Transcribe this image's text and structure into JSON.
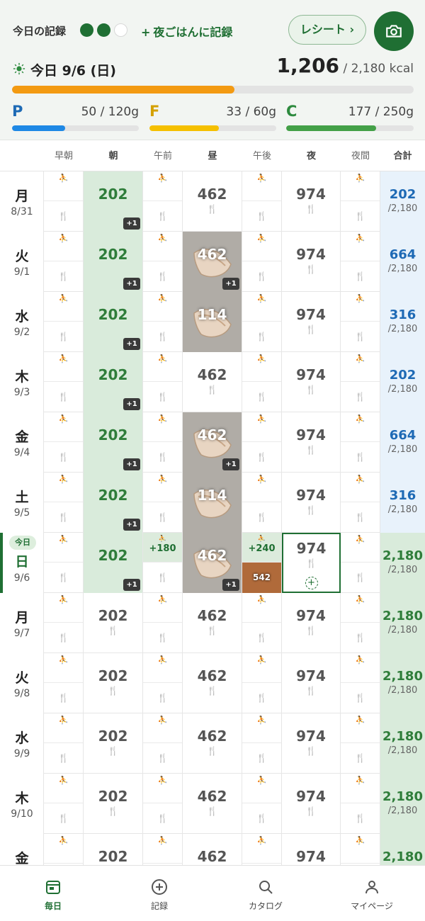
{
  "header": {
    "record_label": "今日の記録",
    "dinner_link": "夜ごはんに記録",
    "receipt_button": "レシート ›",
    "date": "今日 9/6 (日)",
    "kcal_consumed": "1,206",
    "kcal_goal": "/ 2,180 kcal",
    "kcal_progress": 0.553,
    "macros": [
      {
        "letter": "P",
        "value": "50 / 120g",
        "progress": 0.417
      },
      {
        "letter": "F",
        "value": "33 / 60g",
        "progress": 0.55
      },
      {
        "letter": "C",
        "value": "177 / 250g",
        "progress": 0.708
      }
    ]
  },
  "columns": [
    "早朝",
    "朝",
    "午前",
    "昼",
    "午後",
    "夜",
    "夜間",
    "合計"
  ],
  "rows": [
    {
      "dow": "月",
      "date": "8/31",
      "breakfast": {
        "value": "202",
        "extra": "+1"
      },
      "lunch": {
        "value": "462",
        "photo": false
      },
      "dinner": "974",
      "total": "202",
      "goal": "/2,180"
    },
    {
      "dow": "火",
      "date": "9/1",
      "breakfast": {
        "value": "202",
        "extra": "+1"
      },
      "lunch": {
        "value": "462",
        "photo": true,
        "extra": "+1"
      },
      "dinner": "974",
      "total": "664",
      "goal": "/2,180"
    },
    {
      "dow": "水",
      "date": "9/2",
      "breakfast": {
        "value": "202",
        "extra": "+1"
      },
      "lunch": {
        "value": "114",
        "photo": true
      },
      "dinner": "974",
      "total": "316",
      "goal": "/2,180"
    },
    {
      "dow": "木",
      "date": "9/3",
      "breakfast": {
        "value": "202",
        "extra": "+1"
      },
      "lunch": {
        "value": "462",
        "photo": false
      },
      "dinner": "974",
      "total": "202",
      "goal": "/2,180"
    },
    {
      "dow": "金",
      "date": "9/4",
      "breakfast": {
        "value": "202",
        "extra": "+1"
      },
      "lunch": {
        "value": "462",
        "photo": true,
        "extra": "+1"
      },
      "dinner": "974",
      "total": "664",
      "goal": "/2,180"
    },
    {
      "dow": "土",
      "date": "9/5",
      "breakfast": {
        "value": "202",
        "extra": "+1"
      },
      "lunch": {
        "value": "114",
        "photo": true
      },
      "dinner": "974",
      "total": "316",
      "goal": "/2,180"
    },
    {
      "dow": "日",
      "date": "9/6",
      "today": true,
      "today_label": "今日",
      "breakfast": {
        "value": "202",
        "extra": "+1"
      },
      "snack_am": "+180",
      "lunch": {
        "value": "462",
        "photo": true,
        "extra": "+1"
      },
      "snack_pm": "+240",
      "snack_pm_photo": "542",
      "dinner": "974",
      "dinner_selected": true,
      "total": "2,180",
      "goal": "/2,180"
    },
    {
      "dow": "月",
      "date": "9/7",
      "breakfast": {
        "value": "202",
        "plain": true
      },
      "lunch": {
        "value": "462",
        "photo": false
      },
      "dinner": "974",
      "total": "2,180",
      "goal": "/2,180"
    },
    {
      "dow": "火",
      "date": "9/8",
      "breakfast": {
        "value": "202",
        "plain": true
      },
      "lunch": {
        "value": "462",
        "photo": false
      },
      "dinner": "974",
      "total": "2,180",
      "goal": "/2,180"
    },
    {
      "dow": "水",
      "date": "9/9",
      "breakfast": {
        "value": "202",
        "plain": true
      },
      "lunch": {
        "value": "462",
        "photo": false
      },
      "dinner": "974",
      "total": "2,180",
      "goal": "/2,180"
    },
    {
      "dow": "木",
      "date": "9/10",
      "breakfast": {
        "value": "202",
        "plain": true
      },
      "lunch": {
        "value": "462",
        "photo": false
      },
      "dinner": "974",
      "total": "2,180",
      "goal": "/2,180"
    },
    {
      "dow": "金",
      "date": "",
      "breakfast": {
        "value": "202",
        "plain": true
      },
      "lunch": {
        "value": "462",
        "photo": false
      },
      "dinner": "974",
      "total": "2,180",
      "goal": ""
    }
  ],
  "icons": {
    "exercise": "runner-icon",
    "meal": "utensils-icon"
  },
  "nav": [
    "毎日",
    "記録",
    "カタログ",
    "マイページ"
  ]
}
